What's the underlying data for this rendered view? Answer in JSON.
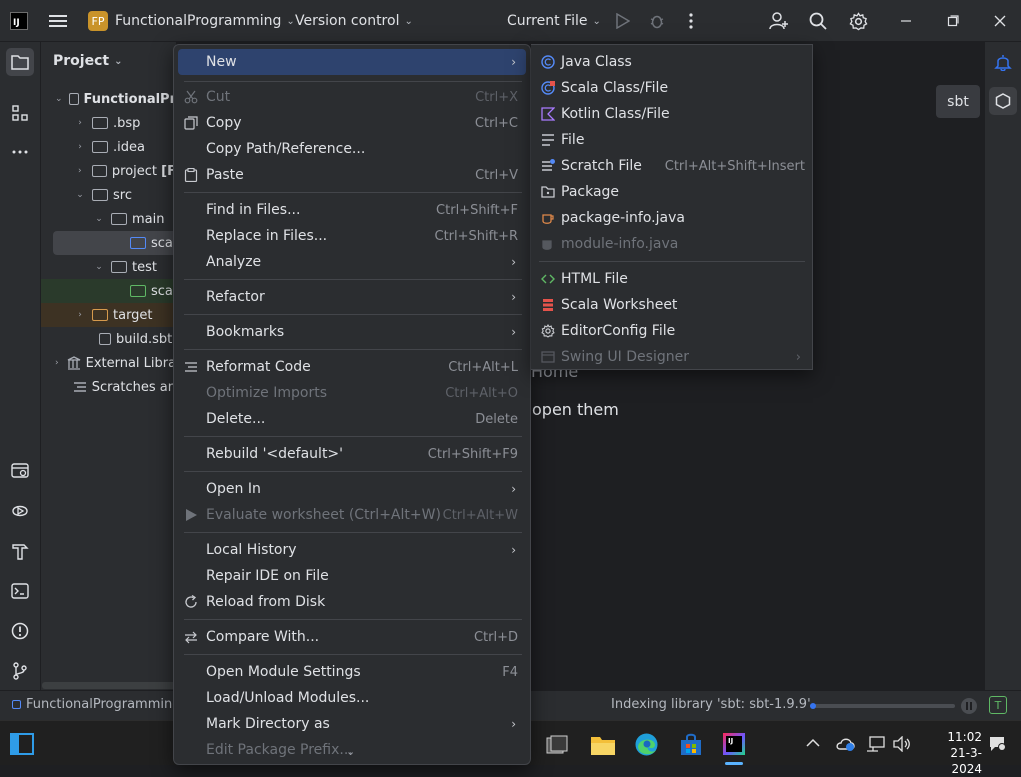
{
  "titlebar": {
    "project_badge": "FP",
    "project_name": "FunctionalProgramming",
    "vcs": "Version control",
    "run_config": "Current File"
  },
  "project_panel": {
    "title": "Project",
    "tree": [
      {
        "label": "FunctionalPr",
        "arrow": "⌄"
      },
      {
        "label": ".bsp",
        "arrow": "›"
      },
      {
        "label": ".idea",
        "arrow": "›"
      },
      {
        "label": "project",
        "suffix": "[F",
        "arrow": "›"
      },
      {
        "label": "src",
        "arrow": "⌄"
      },
      {
        "label": "main",
        "arrow": "⌄"
      },
      {
        "label": "sca",
        "arrow": ""
      },
      {
        "label": "test",
        "arrow": "⌄"
      },
      {
        "label": "sca",
        "arrow": ""
      },
      {
        "label": "target",
        "arrow": "›"
      },
      {
        "label": "build.sbt",
        "arrow": ""
      },
      {
        "label": "External Libra",
        "arrow": "›"
      },
      {
        "label": "Scratches an",
        "arrow": ""
      }
    ]
  },
  "editor": {
    "hint_home": "Home",
    "hint_open": "open them",
    "sbt_button": "sbt"
  },
  "context_menu": {
    "new": "New",
    "cut": "Cut",
    "cut_sc": "Ctrl+X",
    "copy": "Copy",
    "copy_sc": "Ctrl+C",
    "copy_path": "Copy Path/Reference...",
    "paste": "Paste",
    "paste_sc": "Ctrl+V",
    "find": "Find in Files...",
    "find_sc": "Ctrl+Shift+F",
    "replace": "Replace in Files...",
    "replace_sc": "Ctrl+Shift+R",
    "analyze": "Analyze",
    "refactor": "Refactor",
    "bookmarks": "Bookmarks",
    "reformat": "Reformat Code",
    "reformat_sc": "Ctrl+Alt+L",
    "optimize": "Optimize Imports",
    "optimize_sc": "Ctrl+Alt+O",
    "delete": "Delete...",
    "delete_sc": "Delete",
    "rebuild": "Rebuild '<default>'",
    "rebuild_sc": "Ctrl+Shift+F9",
    "open_in": "Open In",
    "evaluate": "Evaluate worksheet (Ctrl+Alt+W)",
    "evaluate_sc": "Ctrl+Alt+W",
    "local_history": "Local History",
    "repair": "Repair IDE on File",
    "reload": "Reload from Disk",
    "compare": "Compare With...",
    "compare_sc": "Ctrl+D",
    "module_settings": "Open Module Settings",
    "module_settings_sc": "F4",
    "load_unload": "Load/Unload Modules...",
    "mark_dir": "Mark Directory as",
    "edit_prefix": "Edit Package Prefix..."
  },
  "new_submenu": {
    "java_class": "Java Class",
    "scala_class": "Scala Class/File",
    "kotlin_class": "Kotlin Class/File",
    "file": "File",
    "scratch": "Scratch File",
    "scratch_sc": "Ctrl+Alt+Shift+Insert",
    "package": "Package",
    "package_info": "package-info.java",
    "module_info": "module-info.java",
    "html": "HTML File",
    "worksheet": "Scala Worksheet",
    "editorconfig": "EditorConfig File",
    "swing": "Swing UI Designer"
  },
  "statusbar": {
    "project": "FunctionalProgramming",
    "indexing": "Indexing library 'sbt: sbt-1.9.9'",
    "indexing_progress": 0.0
  },
  "taskbar": {
    "time": "11:02",
    "date": "21-3-2024"
  },
  "colors": {
    "accent": "#3574f0",
    "selection": "#2e436e",
    "badge": "#c9932a"
  }
}
